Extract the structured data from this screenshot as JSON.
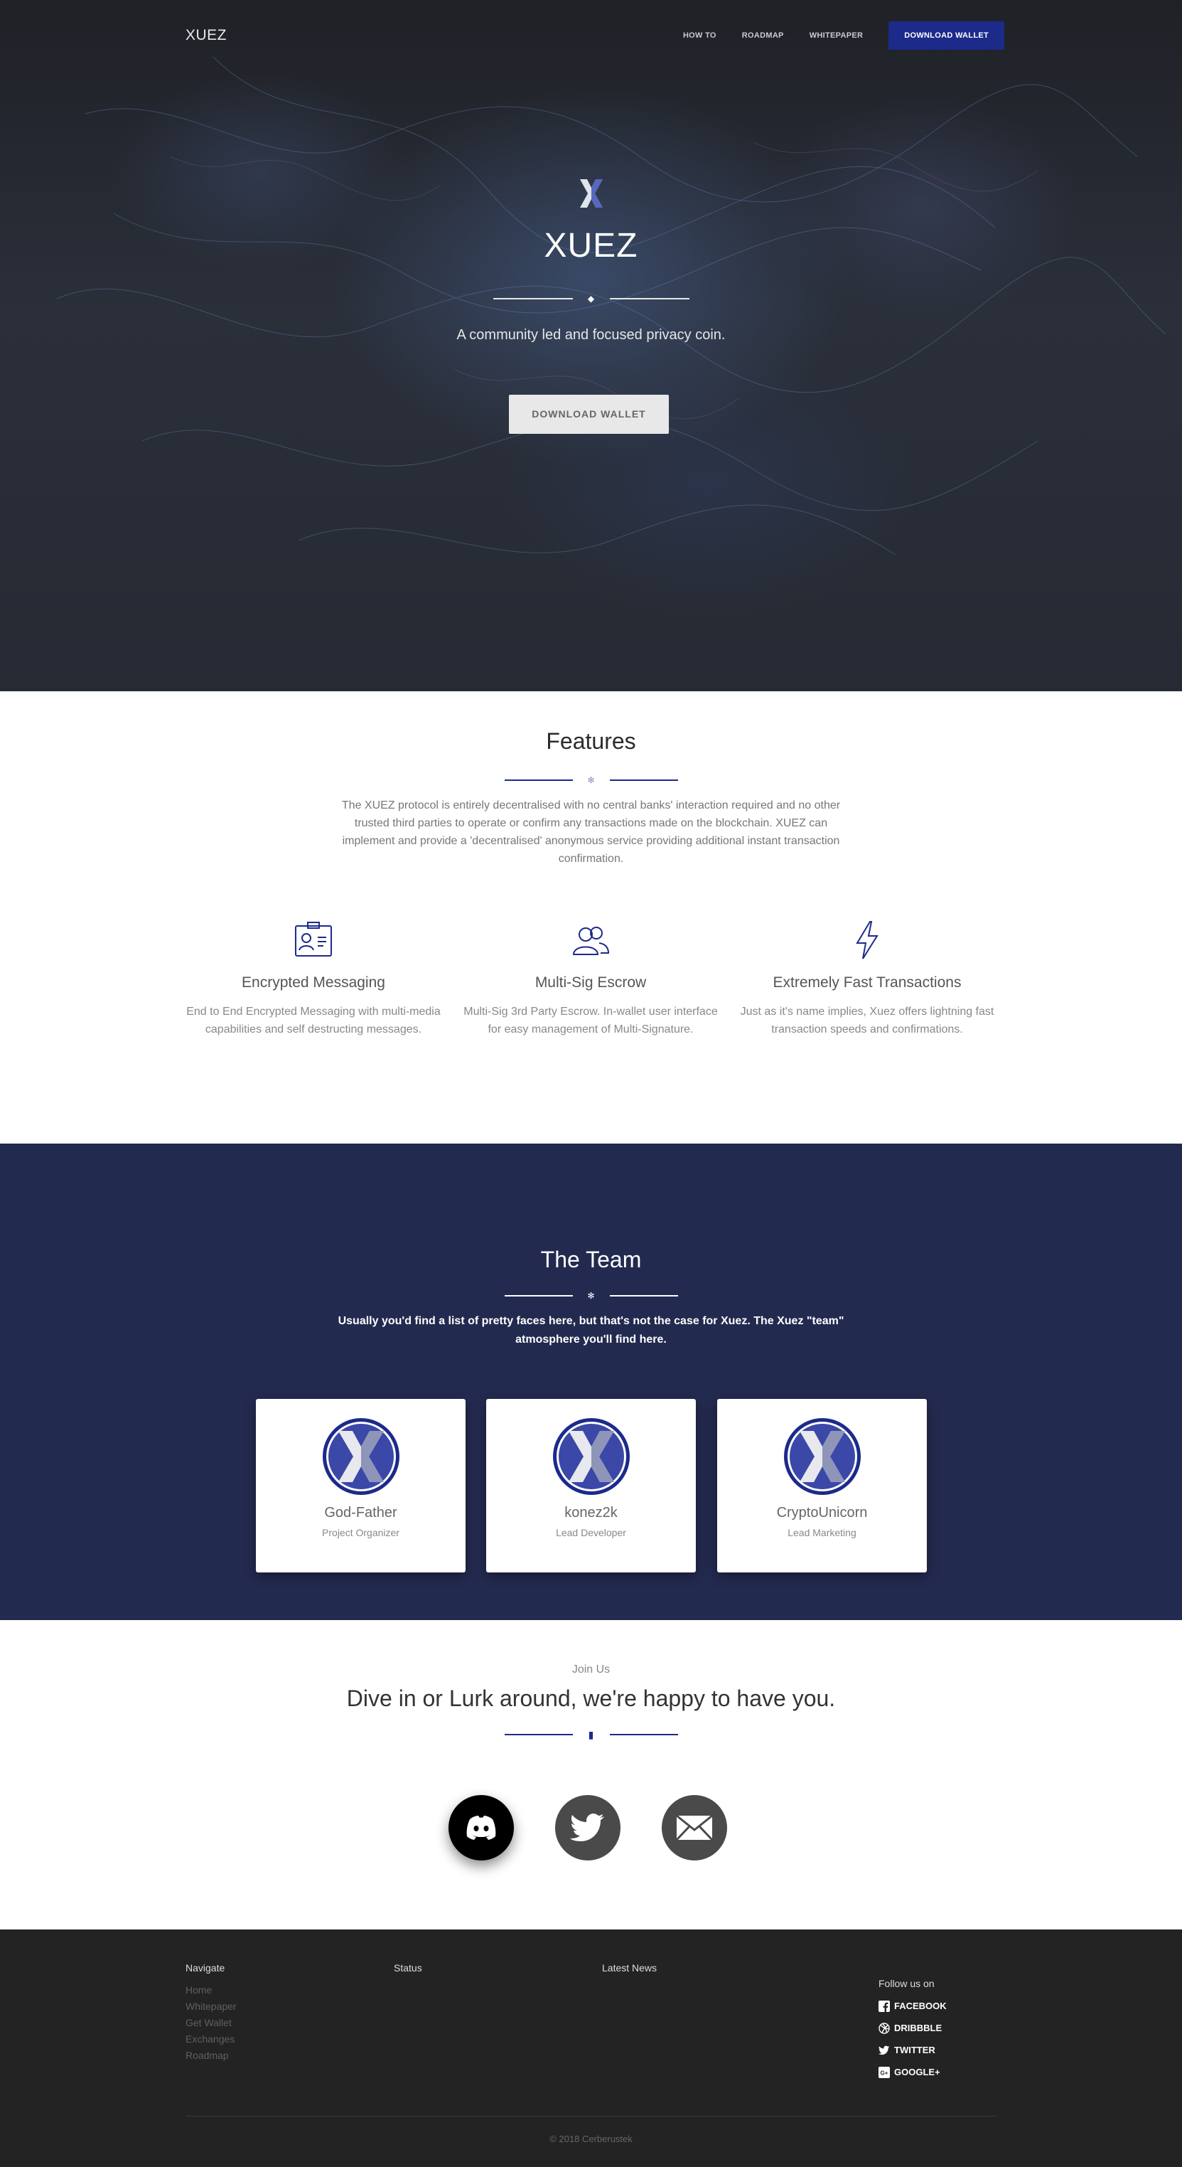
{
  "nav": {
    "brand": "XUEZ",
    "links": [
      "HOW TO",
      "ROADMAP",
      "WHITEPAPER"
    ],
    "cta": "DOWNLOAD WALLET"
  },
  "hero": {
    "title": "XUEZ",
    "subtitle": "A community led and focused privacy coin.",
    "button": "DOWNLOAD WALLET"
  },
  "features": {
    "title": "Features",
    "description": "The XUEZ protocol is entirely decentralised with no central banks' interaction required and no other trusted third parties to operate or confirm any transactions made on the blockchain. XUEZ can implement and provide a 'decentralised' anonymous service providing additional instant transaction confirmation.",
    "items": [
      {
        "icon": "id-card-icon",
        "title": "Encrypted Messaging",
        "text": "End to End Encrypted Messaging with multi-media capabilities and self destructing messages."
      },
      {
        "icon": "users-icon",
        "title": "Multi-Sig Escrow",
        "text": "Multi-Sig 3rd Party Escrow. In-wallet user interface for easy management of Multi-Signature."
      },
      {
        "icon": "lightning-icon",
        "title": "Extremely Fast Transactions",
        "text": "Just as it's name implies, Xuez offers lightning fast transaction speeds and confirmations."
      }
    ]
  },
  "team": {
    "title": "The Team",
    "description": "Usually you'd find a list of pretty faces here, but that's not the case for Xuez. The Xuez \"team\" atmosphere you'll find here.",
    "members": [
      {
        "name": "God-Father",
        "role": "Project Organizer"
      },
      {
        "name": "konez2k",
        "role": "Lead Developer"
      },
      {
        "name": "CryptoUnicorn",
        "role": "Lead Marketing"
      }
    ]
  },
  "join": {
    "kicker": "Join Us",
    "title": "Dive in or Lurk around, we're happy to have you.",
    "socials": [
      "discord-icon",
      "twitter-icon",
      "mail-icon"
    ]
  },
  "footer": {
    "navigate_title": "Navigate",
    "navigate_links": [
      "Home",
      "Whitepaper",
      "Get Wallet",
      "Exchanges",
      "Roadmap"
    ],
    "status_title": "Status",
    "news_title": "Latest News",
    "follow_title": "Follow us on",
    "follow_links": [
      "FACEBOOK",
      "DRIBBBLE",
      "TWITTER",
      "GOOGLE+"
    ],
    "copyright": "© 2018 Cerberustek"
  },
  "colors": {
    "accent_blue": "#1c2a8a",
    "team_bg": "#232a4f",
    "footer_bg": "#232323"
  }
}
